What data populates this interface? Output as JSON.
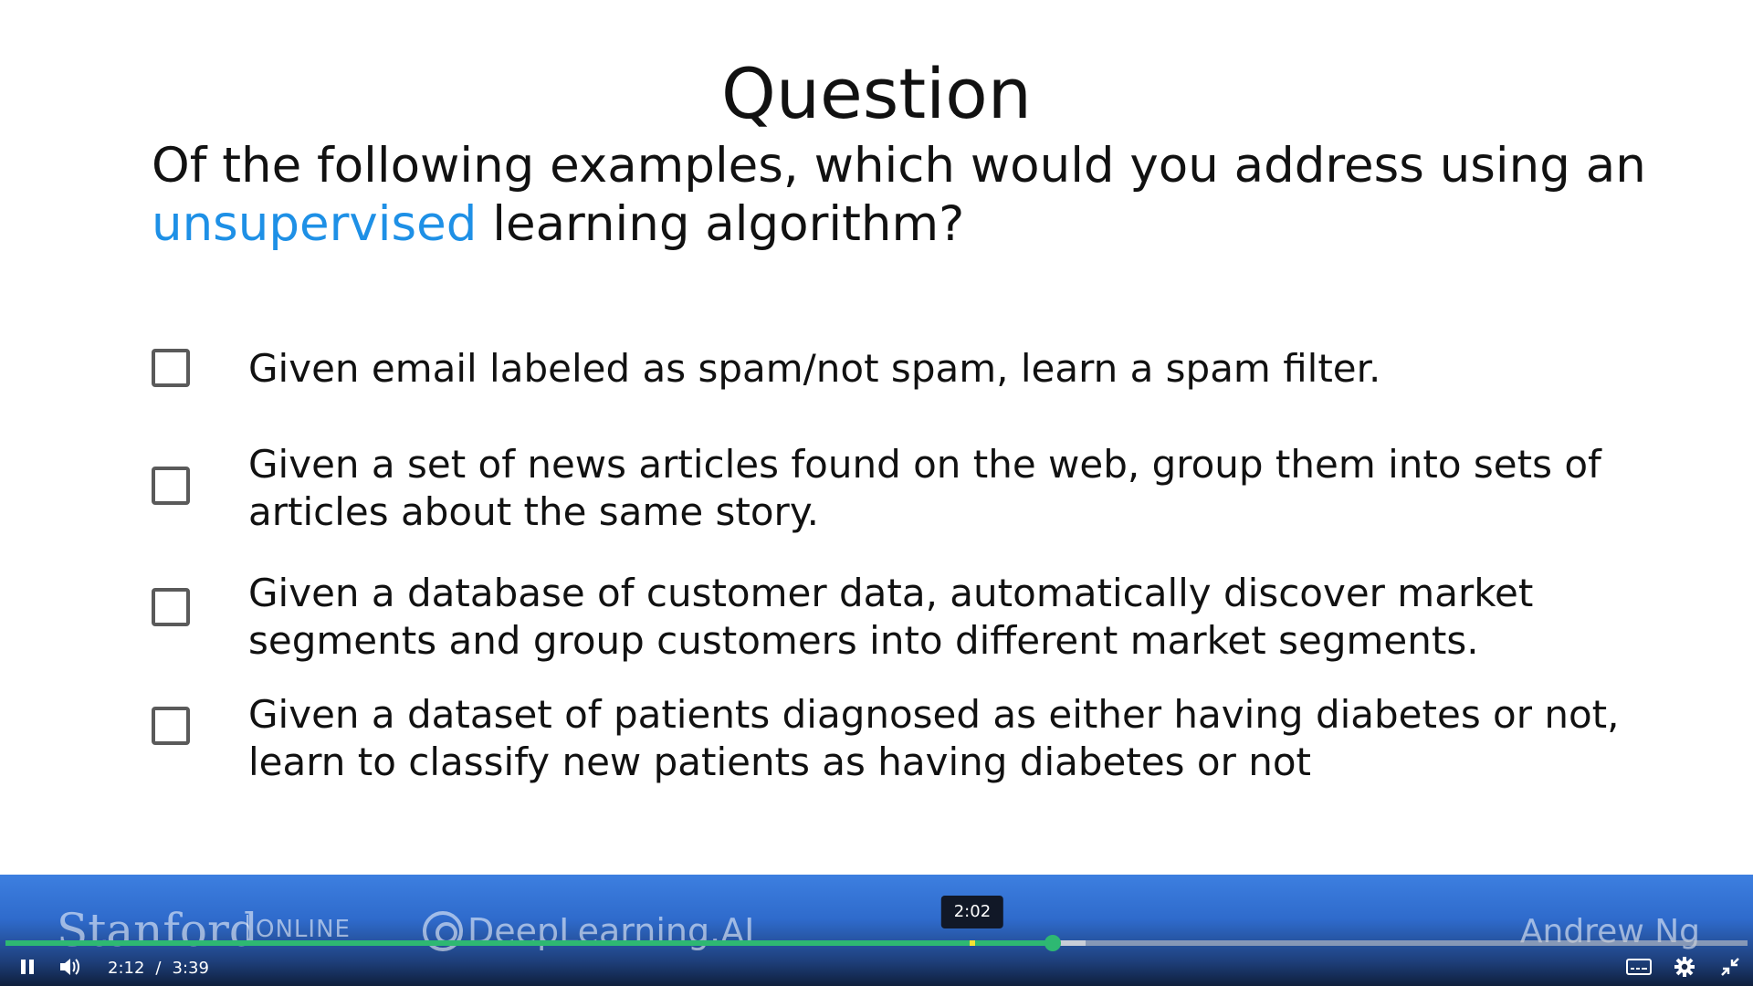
{
  "slide": {
    "title": "Question",
    "question_prefix": "Of the following examples, which would you address using an ",
    "question_highlight": "unsupervised",
    "question_suffix": " learning algorithm?",
    "highlight_color": "#1e90e6",
    "options": [
      {
        "label": "Given email labeled as spam/not spam, learn a spam filter.",
        "checked": false
      },
      {
        "label": "Given a set of news articles found on the web, group them into sets of articles about the same story.",
        "checked": false
      },
      {
        "label": "Given a database of customer data, automatically discover market segments and group customers into different market segments.",
        "checked": false
      },
      {
        "label": "Given a dataset of patients diagnosed as either having diabetes or not, learn to classify new patients as having diabetes or not",
        "checked": false
      }
    ]
  },
  "footer": {
    "stanford": "Stanford",
    "online": "ONLINE",
    "deeplearning": "DeepLearning.AI",
    "instructor": "Andrew Ng"
  },
  "player": {
    "current_time": "2:12",
    "separator": "/",
    "duration": "3:39",
    "hover_time": "2:02",
    "progress_fraction": 0.601,
    "buffered_fraction": 0.62,
    "hover_fraction": 0.555,
    "accent_color": "#2eb872",
    "icons": [
      "pause-icon",
      "volume-icon",
      "captions-icon",
      "settings-icon",
      "exit-fullscreen-icon"
    ]
  }
}
